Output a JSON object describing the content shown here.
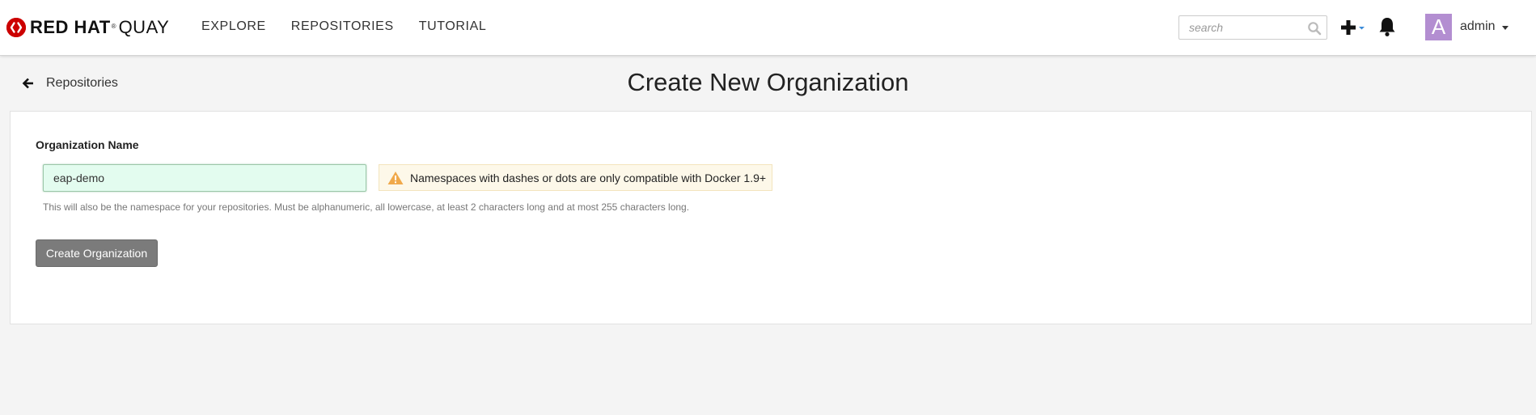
{
  "header": {
    "brand_main": "RED HAT",
    "brand_reg": "®",
    "brand_product": "QUAY",
    "nav": [
      {
        "label": "EXPLORE"
      },
      {
        "label": "REPOSITORIES"
      },
      {
        "label": "TUTORIAL"
      }
    ],
    "search": {
      "placeholder": "search",
      "value": ""
    },
    "icons": {
      "plus": "plus-dropdown-icon",
      "notifications": "bell-icon",
      "search": "search-icon"
    },
    "user": {
      "avatar_letter": "A",
      "name": "admin",
      "avatar_color": "#b38ed1"
    }
  },
  "page": {
    "back_label": "Repositories",
    "title": "Create New Organization"
  },
  "form": {
    "field_label": "Organization Name",
    "org_name_value": "eap-demo",
    "warning_text": "Namespaces with dashes or dots are only compatible with Docker 1.9+",
    "help_text": "This will also be the namespace for your repositories. Must be alphanumeric, all lowercase, at least 2 characters long and at most 255 characters long.",
    "submit_label": "Create Organization"
  },
  "colors": {
    "brand_red": "#cc0000",
    "input_valid_bg": "#e3fcef",
    "warning_bg": "#fdf8e9",
    "warning_icon": "#f0a94b",
    "button_bg": "#7b7b7b",
    "caret_blue": "#3b8bd9"
  }
}
